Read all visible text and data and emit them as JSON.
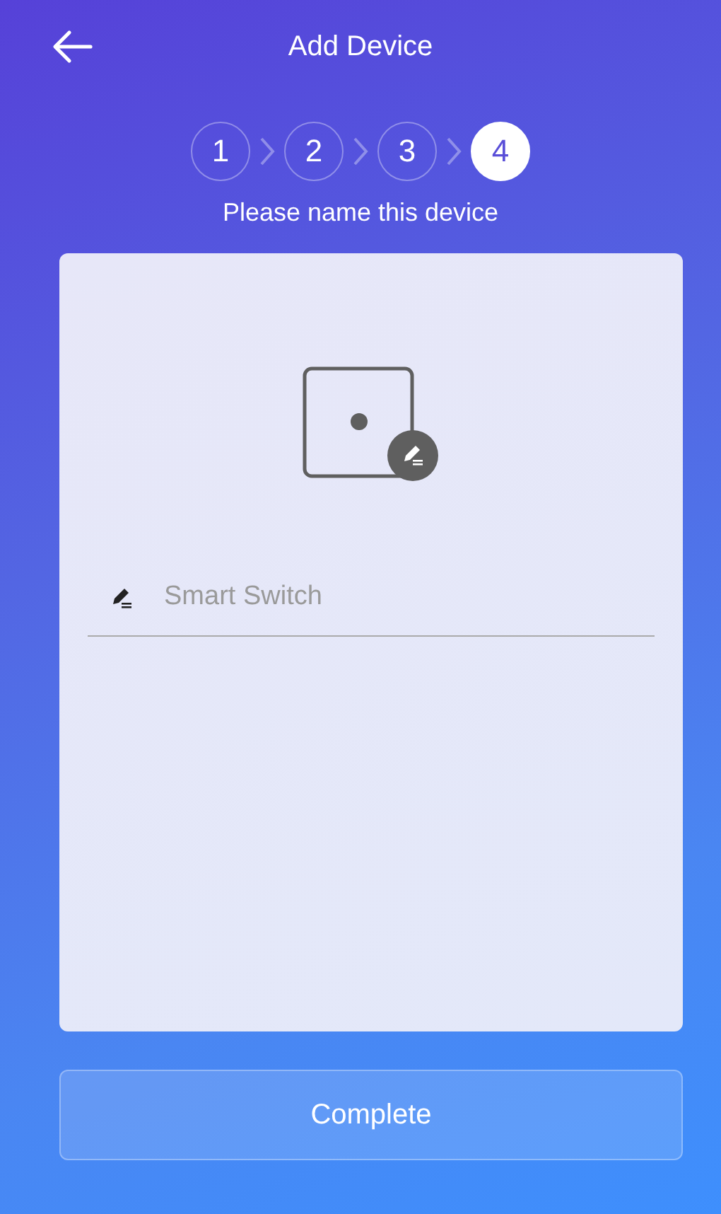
{
  "header": {
    "title": "Add Device"
  },
  "steps": [
    {
      "label": "1",
      "selected": false
    },
    {
      "label": "2",
      "selected": false
    },
    {
      "label": "3",
      "selected": false
    },
    {
      "label": "4",
      "selected": true
    }
  ],
  "instruction": "Please name this device",
  "name_field": {
    "placeholder": "Smart Switch"
  },
  "button": "Complete"
}
